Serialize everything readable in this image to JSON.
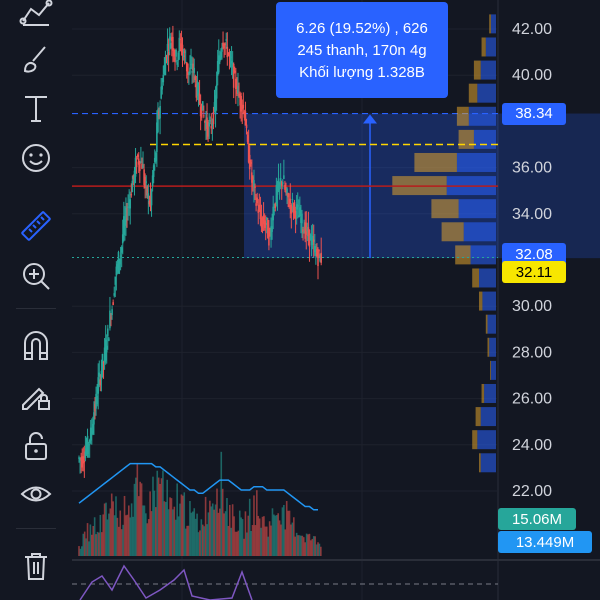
{
  "toolbar": {
    "tools": [
      {
        "name": "pattern-tool-icon",
        "active": false
      },
      {
        "name": "brush-icon",
        "active": false
      },
      {
        "name": "text-tool-icon",
        "active": false
      },
      {
        "name": "smiley-icon",
        "active": false
      },
      {
        "name": "ruler-icon",
        "active": true
      },
      {
        "name": "zoom-in-icon",
        "active": false
      },
      {
        "name": "magnet-icon",
        "active": false
      },
      {
        "name": "lock-pencil-icon",
        "active": false
      },
      {
        "name": "unlock-icon",
        "active": false
      },
      {
        "name": "eye-icon",
        "active": false
      },
      {
        "name": "trash-icon",
        "active": false
      }
    ]
  },
  "tooltip": {
    "line1": "6.26 (19.52%) , 626",
    "line2": "245 thanh, 170n 4g",
    "line3": "Khối lượng 1.328B"
  },
  "price_axis": {
    "ticks": [
      "42.00",
      "40.00",
      "36.00",
      "34.00",
      "30.00",
      "28.00",
      "26.00",
      "24.00",
      "22.00"
    ]
  },
  "badges": {
    "measure_top": "38.34",
    "measure_bottom": "32.08",
    "last_price": "32.11",
    "volume_ma": "15.06M",
    "volume": "13.449M"
  },
  "colors": {
    "background": "#131722",
    "up": "#26a69a",
    "down": "#ef5350",
    "accent": "#2962ff",
    "last_price_badge": "#f7e600",
    "volume_ma_badge": "#26a69a",
    "volume_badge": "#2196f3",
    "poc_line": "#ffd600"
  },
  "chart_data": {
    "type": "candlestick",
    "price_range": [
      20.8,
      43.0
    ],
    "measure_range": [
      32.08,
      38.34
    ],
    "measure_change": 6.26,
    "measure_change_pct": 19.52,
    "red_line_price": 35.2,
    "yellow_dashed_price": 37.0,
    "close_series": [
      23.4,
      23.8,
      24.4,
      25.6,
      26.8,
      27.6,
      28.7,
      30.0,
      31.5,
      32.3,
      33.6,
      34.5,
      35.5,
      36.4,
      36.2,
      35.0,
      34.5,
      36.2,
      38.4,
      40.0,
      41.2,
      41.6,
      40.7,
      41.4,
      40.8,
      40.1,
      40.3,
      39.3,
      38.6,
      37.9,
      37.7,
      38.4,
      40.6,
      41.6,
      41.1,
      40.4,
      39.6,
      39.0,
      38.5,
      36.6,
      35.3,
      34.4,
      33.7,
      33.6,
      33.0,
      34.4,
      35.1,
      35.5,
      34.7,
      34.4,
      34.2,
      33.9,
      33.4,
      33.1,
      32.7,
      32.2,
      32.11
    ],
    "volume_profile_rows": [
      {
        "price": 42.2,
        "up": 6,
        "down": 2
      },
      {
        "price": 41.2,
        "up": 12,
        "down": 5
      },
      {
        "price": 40.2,
        "up": 18,
        "down": 8
      },
      {
        "price": 39.2,
        "up": 22,
        "down": 10
      },
      {
        "price": 38.2,
        "up": 32,
        "down": 14
      },
      {
        "price": 37.2,
        "up": 26,
        "down": 18
      },
      {
        "price": 36.2,
        "up": 46,
        "down": 50
      },
      {
        "price": 35.2,
        "up": 58,
        "down": 64
      },
      {
        "price": 34.2,
        "up": 44,
        "down": 32
      },
      {
        "price": 33.2,
        "up": 38,
        "down": 26
      },
      {
        "price": 32.2,
        "up": 30,
        "down": 18
      },
      {
        "price": 31.2,
        "up": 20,
        "down": 8
      },
      {
        "price": 30.2,
        "up": 16,
        "down": 4
      },
      {
        "price": 29.2,
        "up": 10,
        "down": 2
      },
      {
        "price": 28.2,
        "up": 8,
        "down": 2
      },
      {
        "price": 27.2,
        "up": 6,
        "down": 1
      },
      {
        "price": 26.2,
        "up": 14,
        "down": 3
      },
      {
        "price": 25.2,
        "up": 18,
        "down": 6
      },
      {
        "price": 24.2,
        "up": 22,
        "down": 6
      },
      {
        "price": 23.2,
        "up": 18,
        "down": 2
      }
    ],
    "volume_bars": [
      6,
      9,
      12,
      15,
      10,
      17,
      20,
      24,
      28,
      18,
      22,
      30,
      26,
      34,
      27,
      22,
      25,
      33,
      35,
      37,
      28,
      24,
      19,
      30,
      26,
      22,
      20,
      18,
      16,
      23,
      26,
      31,
      36,
      38,
      27,
      22,
      19,
      17,
      14,
      18,
      21,
      25,
      19,
      17,
      15,
      19,
      23,
      26,
      20,
      17,
      15,
      13,
      11,
      10,
      9,
      8,
      7
    ],
    "volume_ma": [
      16,
      17,
      18,
      19,
      20,
      21,
      22,
      23,
      24,
      25,
      26,
      27,
      28,
      28,
      28,
      28,
      28,
      28,
      27,
      27,
      26,
      25,
      24,
      23,
      22,
      21,
      20,
      20,
      19,
      19,
      20,
      21,
      22,
      23,
      23,
      23,
      22,
      21,
      20,
      20,
      20,
      21,
      21,
      21,
      20,
      20,
      20,
      20,
      20,
      19,
      18,
      17,
      16,
      15,
      15,
      14,
      14
    ],
    "price_ticks": [
      42,
      40,
      36,
      34,
      30,
      28,
      26,
      24,
      22
    ]
  }
}
